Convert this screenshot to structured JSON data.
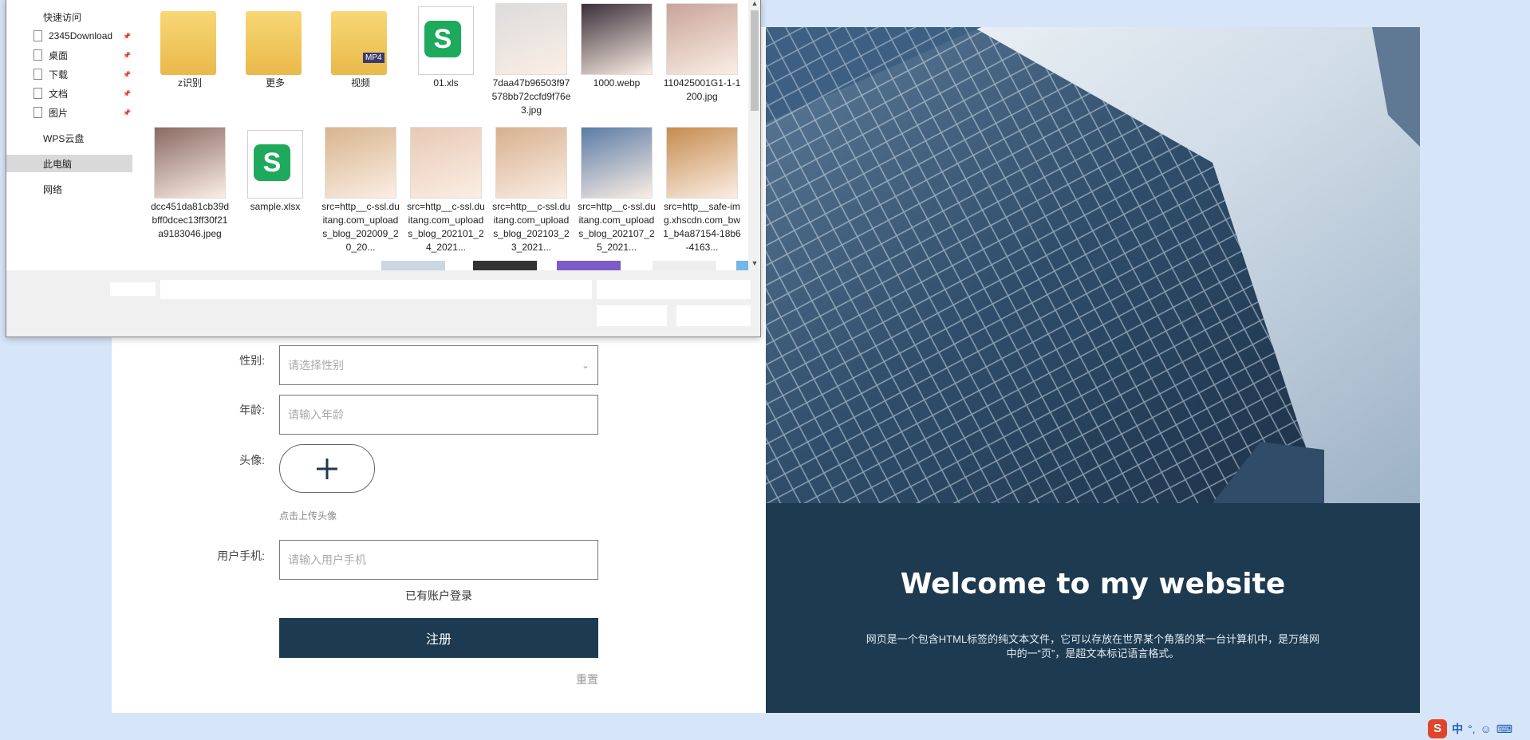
{
  "file_dialog": {
    "nav": [
      {
        "label": "快速访问",
        "pinned": false,
        "icon": "none"
      },
      {
        "label": "2345Download",
        "pinned": true,
        "icon": "file-icon"
      },
      {
        "label": "桌面",
        "pinned": true,
        "icon": "file-icon"
      },
      {
        "label": "下载",
        "pinned": true,
        "icon": "file-icon"
      },
      {
        "label": "文档",
        "pinned": true,
        "icon": "file-icon"
      },
      {
        "label": "图片",
        "pinned": true,
        "icon": "file-icon"
      },
      {
        "label": "WPS云盘",
        "pinned": false,
        "icon": "none"
      },
      {
        "label": "此电脑",
        "pinned": false,
        "icon": "none",
        "selected": true
      },
      {
        "label": "网络",
        "pinned": false,
        "icon": "none"
      }
    ],
    "files": [
      {
        "name": "z识别",
        "type": "folder"
      },
      {
        "name": "更多",
        "type": "folder"
      },
      {
        "name": "视频",
        "type": "folder-video"
      },
      {
        "name": "01.xls",
        "type": "wps-sheet"
      },
      {
        "name": "7daa47b96503f97578bb72ccfd9f76e3.jpg",
        "type": "photo"
      },
      {
        "name": "1000.webp",
        "type": "image"
      },
      {
        "name": "110425001G1-1-1200.jpg",
        "type": "photo"
      },
      {
        "name": "dcc451da81cb39dbff0dcec13ff30f21a9183046.jpeg",
        "type": "photo"
      },
      {
        "name": "sample.xlsx",
        "type": "wps-sheet"
      },
      {
        "name": "src=http__c-ssl.duitang.com_uploads_blog_202009_20_20...",
        "type": "photo"
      },
      {
        "name": "src=http__c-ssl.duitang.com_uploads_blog_202101_24_2021...",
        "type": "photo"
      },
      {
        "name": "src=http__c-ssl.duitang.com_uploads_blog_202103_23_2021...",
        "type": "photo"
      },
      {
        "name": "src=http__c-ssl.duitang.com_uploads_blog_202107_25_2021...",
        "type": "photo"
      },
      {
        "name": "src=http__safe-img.xhscdn.com_bw1_b4a87154-18b6-4163...",
        "type": "photo"
      }
    ]
  },
  "form": {
    "gender_label": "性别:",
    "gender_placeholder": "请选择性别",
    "age_label": "年龄:",
    "age_placeholder": "请输入年龄",
    "avatar_label": "头像:",
    "avatar_hint": "点击上传头像",
    "phone_label": "用户手机:",
    "phone_placeholder": "请输入用户手机",
    "login_link": "已有账户登录",
    "register_button": "注册",
    "reset_link": "重置"
  },
  "hero": {
    "title": "Welcome to my website",
    "description": "网页是一个包含HTML标签的纯文本文件，它可以存放在世界某个角落的某一台计算机中，是万维网中的一“页”，是超文本标记语言格式。"
  },
  "taskbar": {
    "ime_label": "中"
  },
  "colors": {
    "page_bg": "#d6e5f8",
    "dark_navy": "#1d3a50",
    "nav_selected": "#d9d9d9"
  }
}
